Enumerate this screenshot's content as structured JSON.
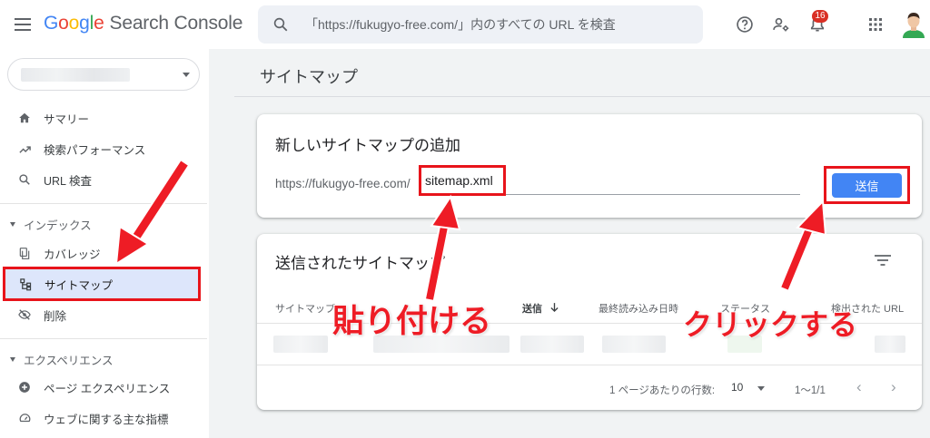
{
  "app": {
    "logo_letters": [
      "G",
      "o",
      "o",
      "g",
      "l",
      "e"
    ],
    "product_name": "Search Console"
  },
  "search": {
    "placeholder": "「https://fukugyo-free.com/」内のすべての URL を検査"
  },
  "topbar": {
    "notification_count": "16"
  },
  "sidebar": {
    "items": [
      {
        "label": "サマリー",
        "icon": "home-icon"
      },
      {
        "label": "検索パフォーマンス",
        "icon": "trending-up-icon"
      },
      {
        "label": "URL 検査",
        "icon": "search-icon"
      }
    ],
    "section_index": {
      "label": "インデックス",
      "items": [
        {
          "label": "カバレッジ",
          "icon": "file-copy-icon"
        },
        {
          "label": "サイトマップ",
          "icon": "sitemap-icon",
          "active": true
        },
        {
          "label": "削除",
          "icon": "visibility-off-icon"
        }
      ]
    },
    "section_experience": {
      "label": "エクスペリエンス",
      "items": [
        {
          "label": "ページ エクスペリエンス",
          "icon": "plus-circle-icon"
        },
        {
          "label": "ウェブに関する主な指標",
          "icon": "speed-gauge-icon"
        }
      ]
    }
  },
  "main": {
    "page_title": "サイトマップ",
    "add_card": {
      "title": "新しいサイトマップの追加",
      "url_prefix": "https://fukugyo-free.com/",
      "input_value": "sitemap.xml",
      "submit_label": "送信"
    },
    "submitted_card": {
      "title": "送信されたサイトマップ",
      "columns": [
        "サイトマップ",
        "送信",
        "最終読み込み日時",
        "ステータス",
        "検出された URL"
      ],
      "footer": {
        "rows_per_page_label": "1 ページあたりの行数:",
        "rows_per_page_value": "10",
        "range": "1〜1/1"
      }
    }
  },
  "annotations": {
    "paste": "貼り付ける",
    "click": "クリックする",
    "color": "#ee1c25"
  }
}
